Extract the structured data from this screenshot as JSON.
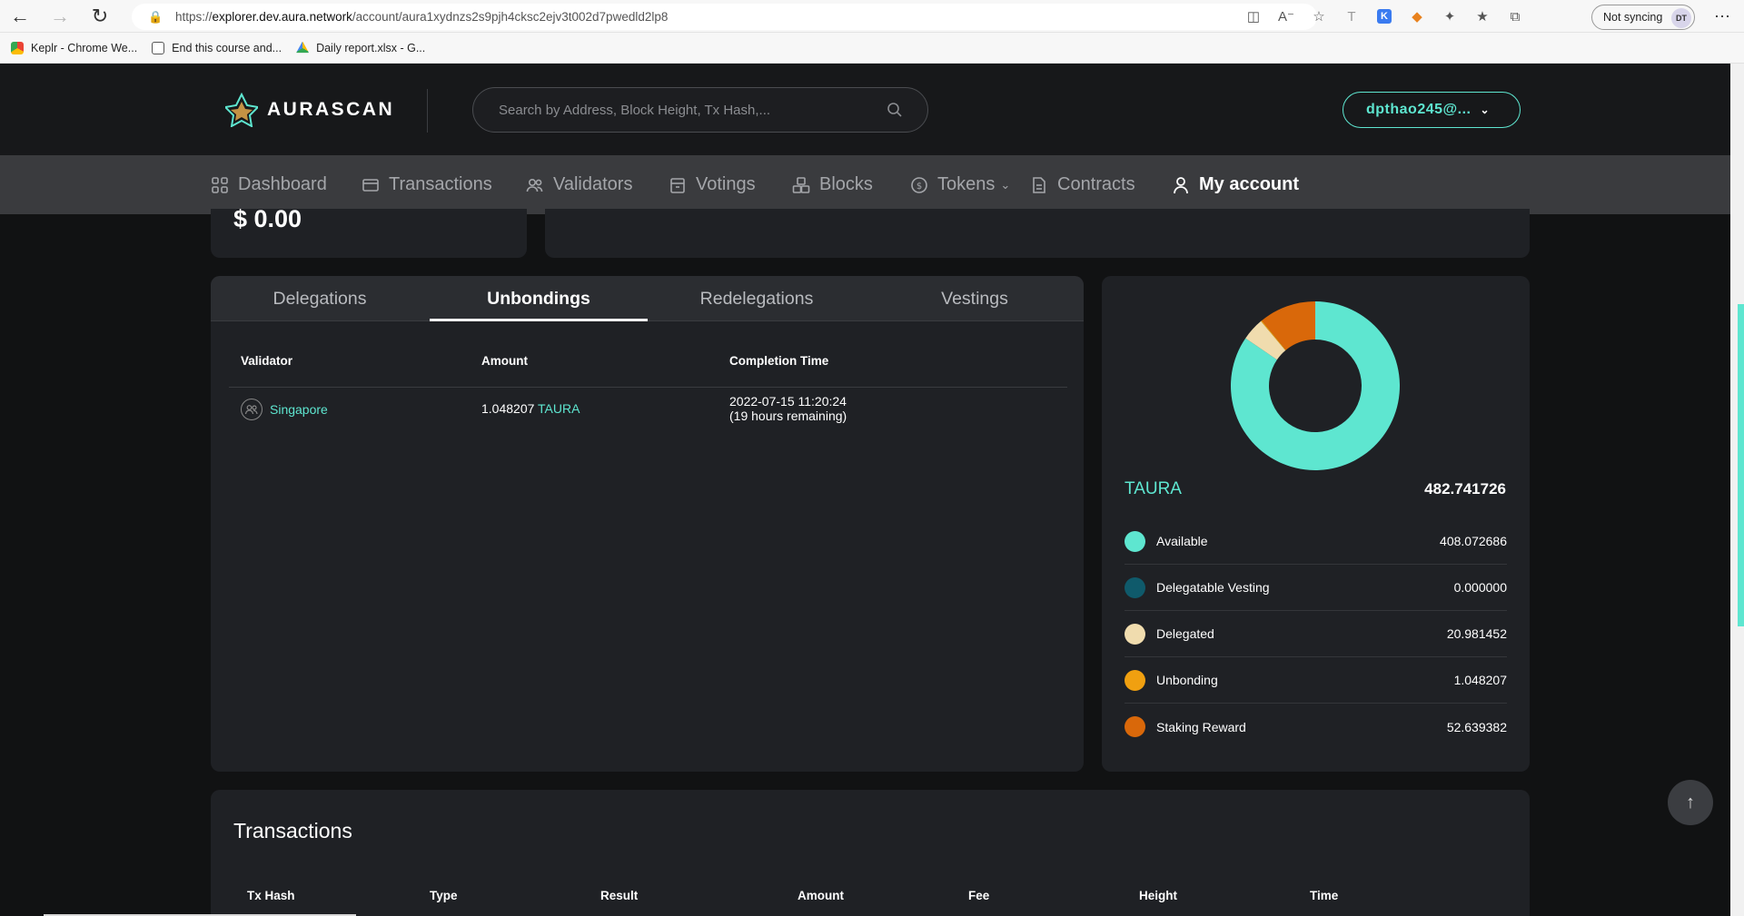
{
  "browser": {
    "url_prefix": "https://",
    "url_host": "explorer.dev.aura.network",
    "url_path": "/account/aura1xydnzs2s9pjh4cksc2ejv3t002d7pwedld2lp8",
    "not_syncing": "Not syncing",
    "profile_initials": "DT",
    "bookmarks": [
      {
        "label": "Keplr - Chrome We..."
      },
      {
        "label": "End this course and..."
      },
      {
        "label": "Daily report.xlsx - G..."
      }
    ]
  },
  "header": {
    "logo_text": "AURASCAN",
    "search_placeholder": "Search by Address, Block Height, Tx Hash,...",
    "account_label": "dpthao245@..."
  },
  "nav": {
    "items": [
      {
        "label": "Dashboard"
      },
      {
        "label": "Transactions"
      },
      {
        "label": "Validators"
      },
      {
        "label": "Votings"
      },
      {
        "label": "Blocks"
      },
      {
        "label": "Tokens"
      },
      {
        "label": "Contracts"
      },
      {
        "label": "My account"
      }
    ]
  },
  "summary": {
    "total_value": "$ 0.00"
  },
  "staking": {
    "tabs": [
      {
        "label": "Delegations"
      },
      {
        "label": "Unbondings"
      },
      {
        "label": "Redelegations"
      },
      {
        "label": "Vestings"
      }
    ],
    "active_tab": "Unbondings",
    "columns": [
      "Validator",
      "Amount",
      "Completion Time"
    ],
    "rows": [
      {
        "validator": "Singapore",
        "amount": "1.048207",
        "denom": "TAURA",
        "completion_time": "2022-07-15 11:20:24",
        "remaining": "(19 hours remaining)"
      }
    ]
  },
  "balance": {
    "token": "TAURA",
    "total": "482.741726",
    "items": [
      {
        "label": "Available",
        "value": "408.072686",
        "color": "#5ee6d0"
      },
      {
        "label": "Delegatable Vesting",
        "value": "0.000000",
        "color": "#0f5a6b"
      },
      {
        "label": "Delegated",
        "value": "20.981452",
        "color": "#f0dcae"
      },
      {
        "label": "Unbonding",
        "value": "1.048207",
        "color": "#f0a010"
      },
      {
        "label": "Staking Reward",
        "value": "52.639382",
        "color": "#d9680a"
      }
    ]
  },
  "chart_data": {
    "type": "pie",
    "categories": [
      "Available",
      "Delegatable Vesting",
      "Delegated",
      "Unbonding",
      "Staking Reward"
    ],
    "values": [
      408.072686,
      0.0,
      20.981452,
      1.048207,
      52.639382
    ]
  },
  "transactions": {
    "title": "Transactions",
    "columns": [
      "Tx Hash",
      "Type",
      "Result",
      "Amount",
      "Fee",
      "Height",
      "Time"
    ]
  }
}
